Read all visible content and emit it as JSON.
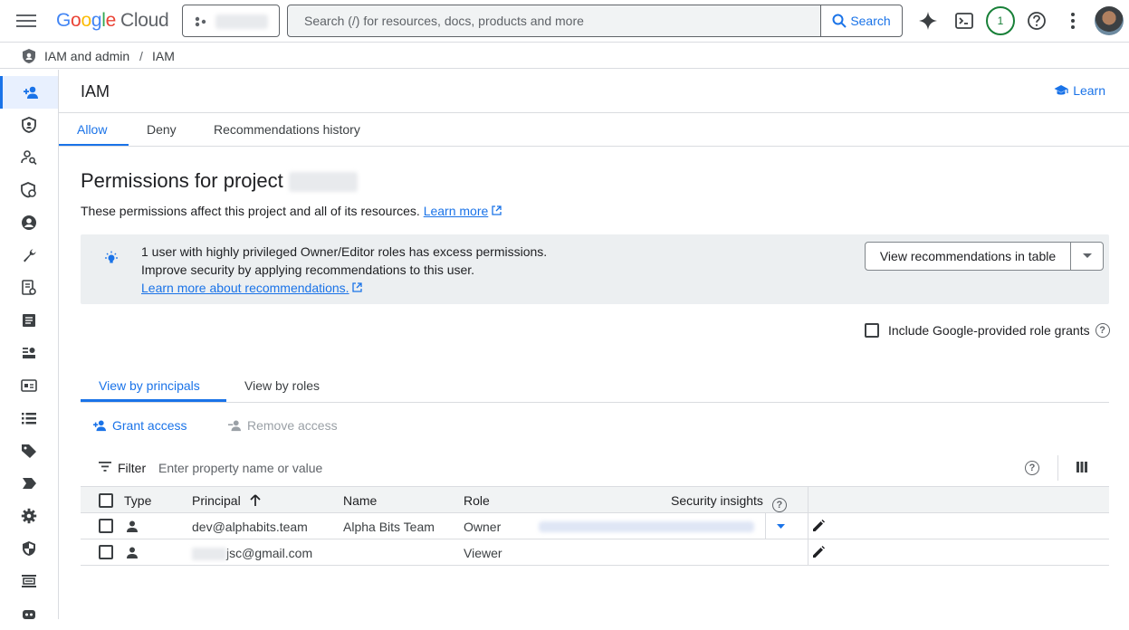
{
  "topbar": {
    "brand": {
      "G": "G",
      "o1": "o",
      "o2": "o",
      "g": "g",
      "l": "l",
      "e": "e",
      "cloud": "Cloud"
    },
    "search_placeholder": "Search (/) for resources, docs, products and more",
    "search_button": "Search",
    "notifications_count": "1",
    "icons": [
      "menu-icon",
      "gemini-icon",
      "cloud-shell-icon",
      "help-icon",
      "more-vert-icon"
    ]
  },
  "breadcrumb": {
    "level1": "IAM and admin",
    "separator": "/",
    "level2": "IAM"
  },
  "sidenav": {
    "icons": [
      "person-add-icon",
      "shield-icon",
      "identity-icon",
      "policy-icon",
      "account-circle-icon",
      "wrench-icon",
      "audit-icon",
      "document-icon",
      "key-icon",
      "card-icon",
      "list-icon",
      "tag-icon",
      "label-icon",
      "settings-icon",
      "security-icon",
      "quotas-icon",
      "robot-icon"
    ]
  },
  "header": {
    "title": "IAM",
    "learn": "Learn"
  },
  "tabs": [
    {
      "label": "Allow",
      "active": true
    },
    {
      "label": "Deny",
      "active": false
    },
    {
      "label": "Recommendations history",
      "active": false
    }
  ],
  "permissions": {
    "title": "Permissions for project",
    "description": "These permissions affect this project and all of its resources.",
    "learn_more": "Learn more"
  },
  "recommendation": {
    "line1": "1 user with highly privileged Owner/Editor roles has excess permissions.",
    "line2": "Improve security by applying recommendations to this user.",
    "link": "Learn more about recommendations.",
    "button": "View recommendations in table"
  },
  "include_grants": {
    "label": "Include Google-provided role grants",
    "checked": false
  },
  "subtabs": [
    {
      "label": "View by principals",
      "active": true
    },
    {
      "label": "View by roles",
      "active": false
    }
  ],
  "actions": {
    "grant": "Grant access",
    "remove": "Remove access"
  },
  "filter": {
    "label": "Filter",
    "placeholder": "Enter property name or value"
  },
  "table": {
    "headers": {
      "type": "Type",
      "principal": "Principal",
      "name": "Name",
      "role": "Role",
      "insights": "Security insights"
    },
    "rows": [
      {
        "principal": "dev@alphabits.team",
        "name": "Alpha Bits Team",
        "role": "Owner"
      },
      {
        "principal": "jsc@gmail.com",
        "name": "",
        "role": "Viewer"
      }
    ]
  },
  "colors": {
    "accent": "#1a73e8",
    "border": "#dadce0",
    "rec_bg": "#eceff1",
    "notif_green": "#188038"
  }
}
